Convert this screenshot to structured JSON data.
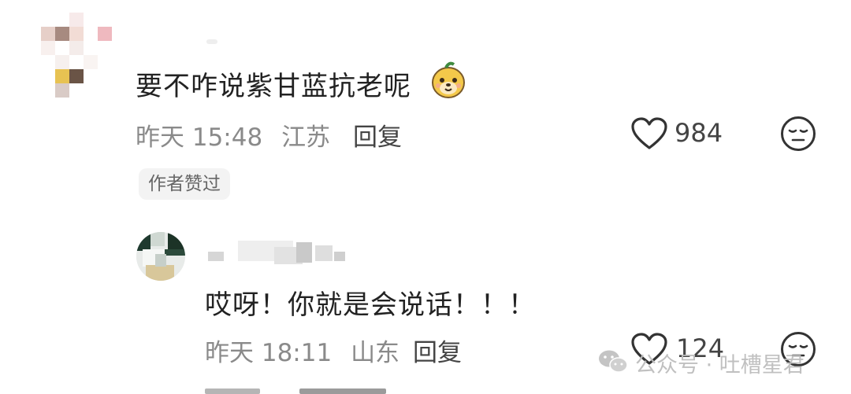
{
  "comments": [
    {
      "text": "要不咋说紫甘蓝抗老呢",
      "emoji": "bear-face-emoji",
      "time": "昨天 15:48",
      "location": "江苏",
      "reply_label": "回复",
      "like_count": "984",
      "author_liked_tag": "作者赞过"
    },
    {
      "text": "哎呀！你就是会说话！！！",
      "time": "昨天 18:11",
      "location": "山东",
      "reply_label": "回复",
      "like_count": "124"
    }
  ],
  "watermark": {
    "text": "公众号 · 吐槽星君",
    "icon": "wechat-icon"
  },
  "colors": {
    "text_primary": "#222222",
    "text_meta": "#8a8a8a",
    "icon_stroke": "#333333",
    "pill_bg": "#f3f3f3",
    "watermark": "#bdbdbd"
  }
}
